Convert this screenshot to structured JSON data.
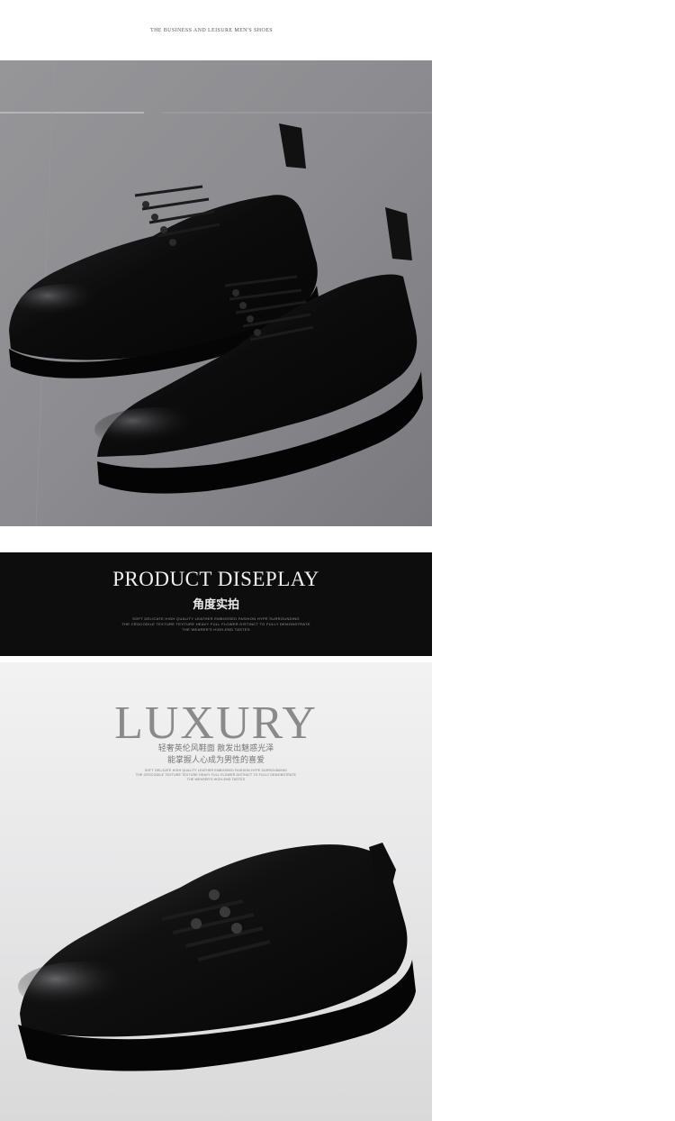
{
  "header": {
    "caption": "THE BUSINESS AND LEISURE MEN'S SHOES"
  },
  "banner": {
    "title": "PRODUCT DISEPLAY",
    "subtitle_cn": "角度实拍",
    "small_lines": [
      "SOFT DELICATE HIGH QUALITY LEATHER EMBOSSED FASHION HYPE SURROUNDING",
      "THE CROCODILE TEXTURE TEXTURE HEAVY FULL FLOWER DISTINCT TO FULLY DEMONSTRATE",
      "THE WEARER'S HIGH-END TASTES"
    ]
  },
  "luxury": {
    "title": "LUXURY",
    "cn_line1": "轻奢英伦风鞋面 散发出魅惑光泽",
    "cn_line2": "能掌握人心成为男性的喜爱",
    "small_lines": [
      "SOFT DELICATE HIGH QUALITY LEATHER EMBOSSED FASHION HYPE SURROUNDING",
      "THE CROCODILE TEXTURE TEXTURE HEAVY FULL FLOWER DISTINCT TO FULLY DEMONSTRATE",
      "THE WEARER'S HIGH-END TASTES"
    ]
  },
  "images": {
    "photo1": "pair-of-black-leather-derby-shoes-on-grey-concrete",
    "photo2": "single-black-leather-derby-shoe-on-light-grey"
  },
  "colors": {
    "banner_bg": "#0d0d0d",
    "shoe_leather": "#111111"
  }
}
